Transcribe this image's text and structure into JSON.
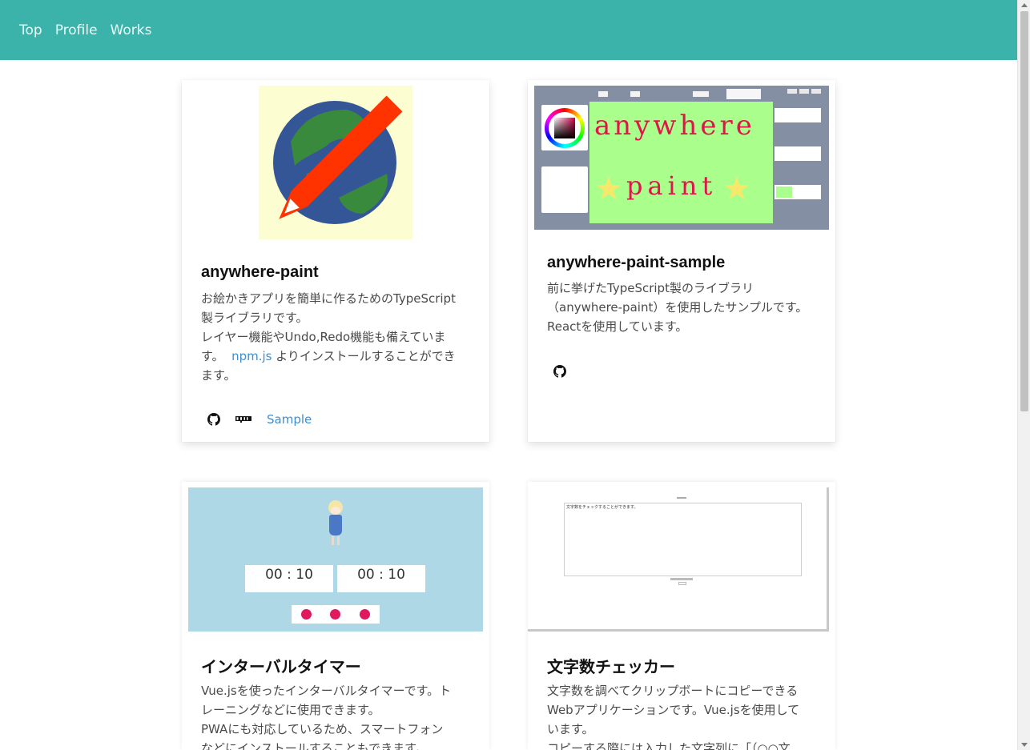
{
  "nav": {
    "items": [
      {
        "label": "Top"
      },
      {
        "label": "Profile"
      },
      {
        "label": "Works"
      }
    ]
  },
  "cards": [
    {
      "title": "anywhere-paint",
      "lines": [
        "お絵かきアプリを簡単に作るためのTypeScript",
        "製ライブラリです。",
        "レイヤー機能やUndo,Redo機能も備えていま",
        "す。",
        "npm.js",
        "よりインストールすることができ",
        "ます。"
      ],
      "footer": {
        "github_icon": "github-icon",
        "npm_icon": "npm-icon",
        "sample_label": "Sample"
      }
    },
    {
      "title": "anywhere-paint-sample",
      "lines": [
        "前に挙げたTypeScript製のライブラリ",
        "（anywhere-paint）を使用したサンプルです。",
        "Reactを使用しています。"
      ],
      "thumb_text": [
        "anywhere",
        "paint"
      ],
      "footer": {
        "github_icon": "github-icon"
      }
    },
    {
      "title": "インターバルタイマー",
      "lines": [
        "Vue.jsを使ったインターバルタイマーです。ト",
        "レーニングなどに使用できます。",
        "PWAにも対応しているため、スマートフォン",
        "などにインストールすることもできます。"
      ],
      "thumb_timers": [
        "00 : 10",
        "00 : 10"
      ]
    },
    {
      "title": "文字数チェッカー",
      "lines": [
        "文字数を調べてクリップボートにコピーできる",
        "Webアプリケーションです。Vue.jsを使用して",
        "います。",
        "コピーする際には入力した文字列に「（○○文"
      ],
      "thumb_text": "文字数をチェックすることができます。"
    }
  ],
  "colors": {
    "navbar": "#3bb3ab",
    "link": "#3e8ed0"
  }
}
